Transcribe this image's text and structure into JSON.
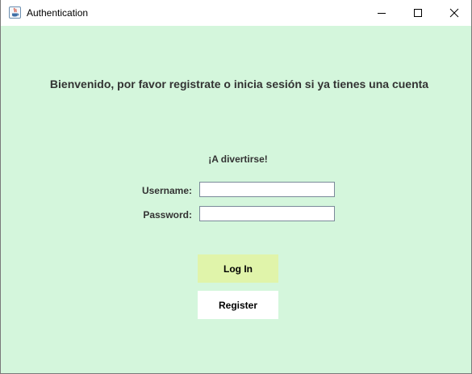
{
  "window": {
    "title": "Authentication",
    "app_icon": "java-cup-icon",
    "controls": {
      "minimize_icon": "minimize-icon",
      "maximize_icon": "maximize-icon",
      "close_icon": "close-icon"
    }
  },
  "main": {
    "welcome": "Bienvenido, por favor registrate o inicia sesión si ya tienes una cuenta",
    "tagline": "¡A divertirse!",
    "username_label": "Username:",
    "username_value": "",
    "password_label": "Password:",
    "password_value": "",
    "login_label": "Log In",
    "register_label": "Register"
  },
  "colors": {
    "background": "#d4f6dc",
    "login_button": "#e0f4aa",
    "register_button": "#ffffff",
    "text": "#333333"
  }
}
